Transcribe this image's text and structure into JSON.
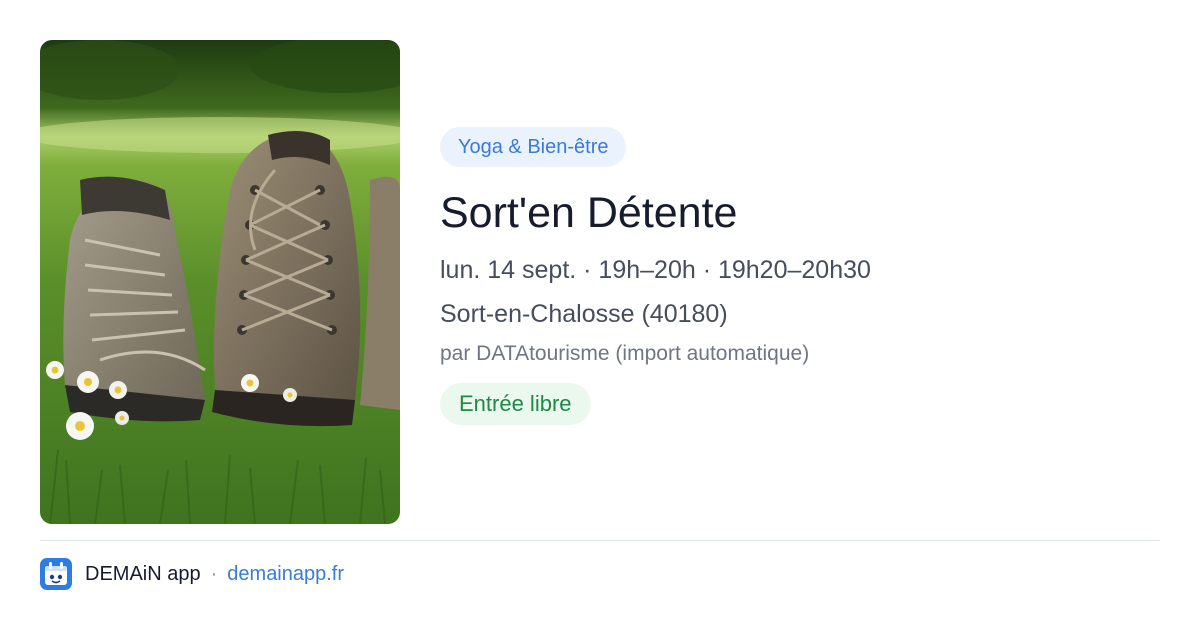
{
  "event": {
    "category": "Yoga & Bien-être",
    "title": "Sort'en Détente",
    "schedule": "lun. 14 sept. · 19h–20h · 19h20–20h30",
    "location": "Sort-en-Chalosse (40180)",
    "source": "par DATAtourisme (import automatique)",
    "price": "Entrée libre",
    "image": "hiking-boots-in-grass-with-daisies"
  },
  "footer": {
    "app_name": "DEMAiN app",
    "separator": "·",
    "link": "demainapp.fr",
    "logo_icon": "demain-app-icon"
  },
  "colors": {
    "category_bg": "#eaf2fd",
    "category_text": "#3a7bd5",
    "price_bg": "#eaf8ee",
    "price_text": "#1f8a45",
    "title_text": "#161b2e",
    "link_text": "#3a7bd5"
  }
}
